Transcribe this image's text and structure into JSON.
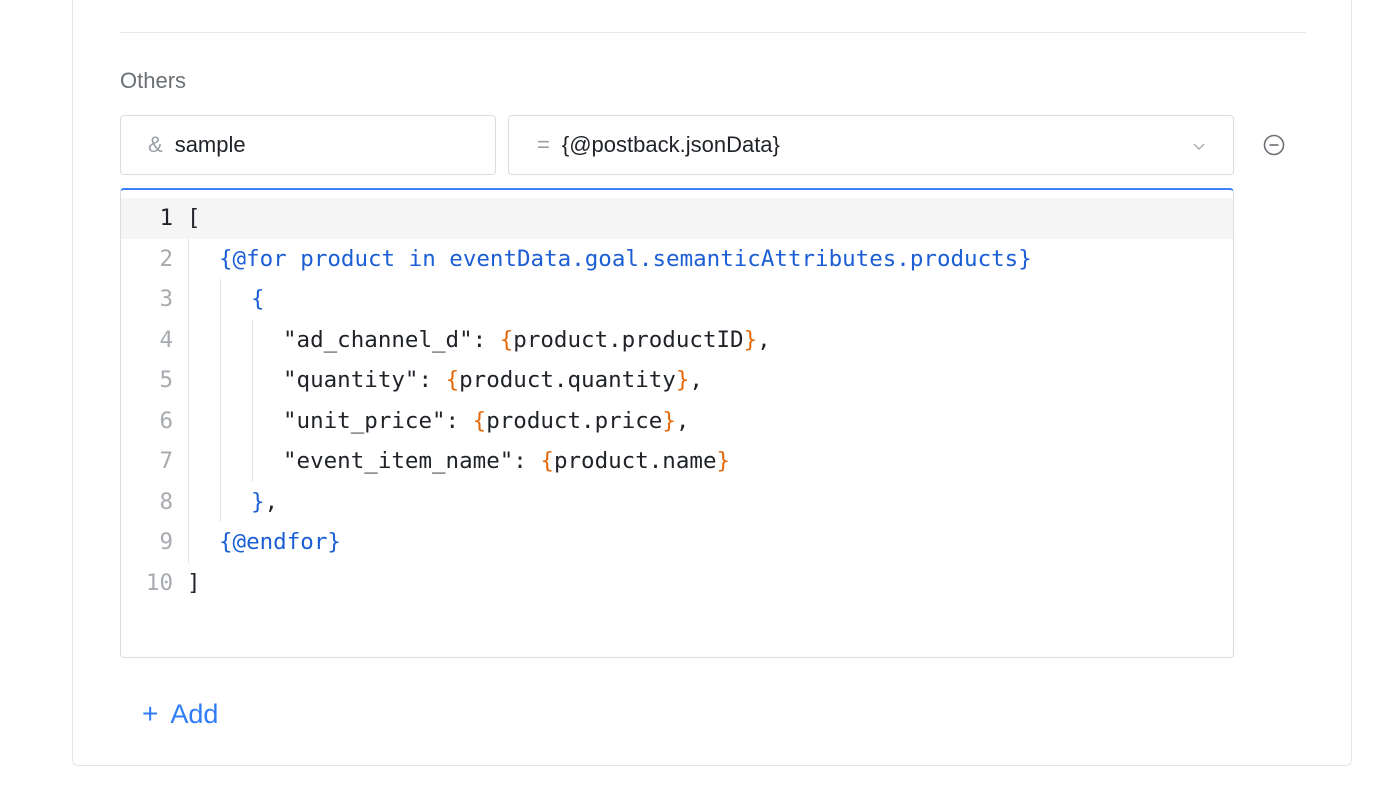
{
  "section": {
    "label": "Others"
  },
  "param": {
    "key_prefix": "&",
    "key": "sample",
    "value_prefix": "=",
    "value": "{@postback.jsonData}"
  },
  "editor": {
    "lines": [
      {
        "n": "1",
        "indent": 0,
        "tokens": [
          [
            "plain",
            "["
          ]
        ]
      },
      {
        "n": "2",
        "indent": 1,
        "tokens": [
          [
            "blue",
            "{@for product in eventData.goal.semanticAttributes.products}"
          ]
        ]
      },
      {
        "n": "3",
        "indent": 2,
        "tokens": [
          [
            "blue",
            "{"
          ]
        ]
      },
      {
        "n": "4",
        "indent": 3,
        "tokens": [
          [
            "plain",
            "\"ad_channel_d\": "
          ],
          [
            "orange",
            "{"
          ],
          [
            "plain",
            "product.productID"
          ],
          [
            "orange",
            "}"
          ],
          [
            "plain",
            ","
          ]
        ]
      },
      {
        "n": "5",
        "indent": 3,
        "tokens": [
          [
            "plain",
            "\"quantity\": "
          ],
          [
            "orange",
            "{"
          ],
          [
            "plain",
            "product.quantity"
          ],
          [
            "orange",
            "}"
          ],
          [
            "plain",
            ","
          ]
        ]
      },
      {
        "n": "6",
        "indent": 3,
        "tokens": [
          [
            "plain",
            "\"unit_price\": "
          ],
          [
            "orange",
            "{"
          ],
          [
            "plain",
            "product.price"
          ],
          [
            "orange",
            "}"
          ],
          [
            "plain",
            ","
          ]
        ]
      },
      {
        "n": "7",
        "indent": 3,
        "tokens": [
          [
            "plain",
            "\"event_item_name\": "
          ],
          [
            "orange",
            "{"
          ],
          [
            "plain",
            "product.name"
          ],
          [
            "orange",
            "}"
          ]
        ]
      },
      {
        "n": "8",
        "indent": 2,
        "tokens": [
          [
            "blue",
            "}"
          ],
          [
            "plain",
            ","
          ]
        ]
      },
      {
        "n": "9",
        "indent": 1,
        "tokens": [
          [
            "blue",
            "{@endfor}"
          ]
        ]
      },
      {
        "n": "10",
        "indent": 0,
        "tokens": [
          [
            "plain",
            "]"
          ]
        ]
      }
    ],
    "active_line": 1
  },
  "actions": {
    "add_label": "Add",
    "add_icon": "plus-icon",
    "remove_icon": "minus-circle-icon"
  },
  "colors": {
    "accent": "#2f7cf6",
    "keyword": "#1c5fd4",
    "interpolation": "#e36a0c"
  }
}
